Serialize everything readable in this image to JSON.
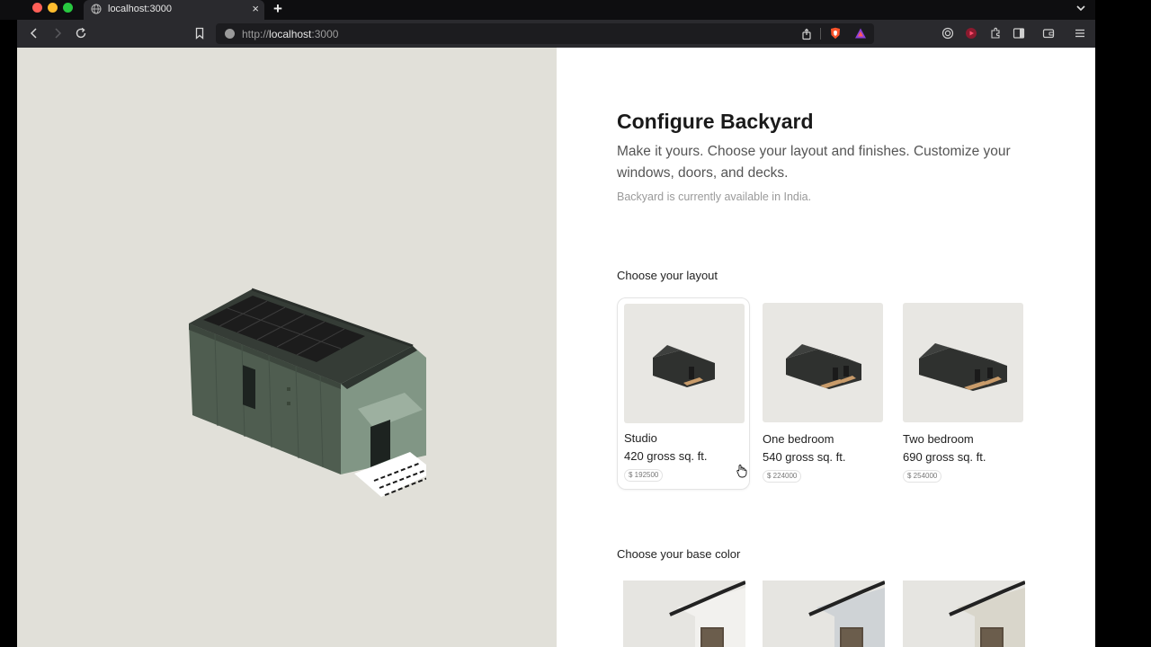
{
  "browser": {
    "tab_title": "localhost:3000",
    "close_glyph": "×",
    "new_tab_glyph": "+",
    "url_scheme": "http://",
    "url_host": "localhost",
    "url_port": ":3000"
  },
  "configurator": {
    "title": "Configure Backyard",
    "subtitle": "Make it yours. Choose your layout and finishes. Customize your windows, doors, and decks.",
    "availability": "Backyard is currently available in India.",
    "layout_label": "Choose your layout",
    "color_label": "Choose your base color",
    "layouts": [
      {
        "name": "Studio",
        "area": "420 gross sq. ft.",
        "price": "$ 192500",
        "selected": true
      },
      {
        "name": "One bedroom",
        "area": "540 gross sq. ft.",
        "price": "$ 224000",
        "selected": false
      },
      {
        "name": "Two bedroom",
        "area": "690 gross sq. ft.",
        "price": "$ 254000",
        "selected": false
      }
    ],
    "base_colors": [
      {
        "swatch": "#f2f1ee"
      },
      {
        "swatch": "#cfd3d6"
      },
      {
        "swatch": "#d9d6cb"
      }
    ]
  },
  "colors": {
    "preview_bg": "#e1e0d9",
    "house_siding": "#4f5d50",
    "solar_panel": "#1c1c1c",
    "thumb_bg": "#e8e7e3"
  },
  "icons": [
    "globe-icon",
    "close-icon",
    "plus-icon",
    "chevron-down-icon",
    "back-icon",
    "forward-icon",
    "reload-icon",
    "bookmark-icon",
    "share-icon",
    "brave-shield-icon",
    "rewards-icon",
    "extension-icon",
    "record-icon",
    "puzzle-icon",
    "sidebar-icon",
    "wallet-icon",
    "menu-icon",
    "cursor-icon"
  ]
}
